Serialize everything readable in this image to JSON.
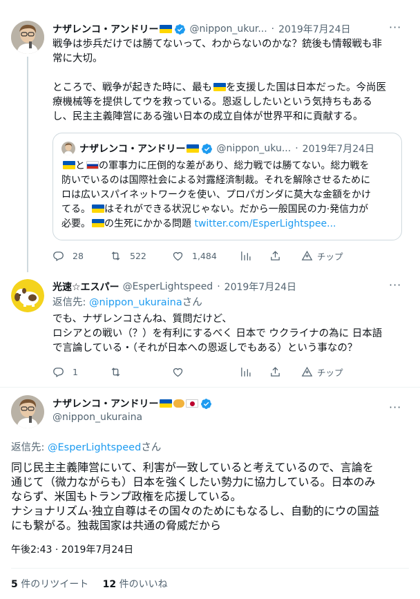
{
  "tweet1": {
    "name": "ナザレンコ・アンドリー",
    "handle": "@nippon_ukur...",
    "dot": "·",
    "date": "2019年7月24日",
    "text_line1": "戦争は歩兵だけでは勝てないって、わからないのかな？銃後も情報戦も非",
    "text_line2": "常に大切。",
    "text_line3a": "ところで、戦争が起きた時に、最も",
    "text_line3b": "を支援した国は日本だった。今尚医",
    "text_line4": "療機械等を提供してウを救っている。恩返ししたいという気持ちもある",
    "text_line5": "し、民主主義陣営にある強い日本の成立自体が世界平和に貢献する。",
    "quote": {
      "name": "ナザレンコ・アンドリー",
      "handle": "@nippon_uku...",
      "dot": "·",
      "date": "2019年7月24日",
      "line1a": "と",
      "line1b": "の軍事力に圧倒的な差があり、総力戦では勝てない。総力戦を",
      "line2": "防いでいるのは国際社会による対露経済制裁。それを解除させるために",
      "line3": "ロは広いスパイネットワークを使い、プロパガンダに莫大な金額をかけ",
      "line4a": "てる。",
      "line4b": "はそれができる状況じゃない。だから一般国民の力·発信力が",
      "line5": "必要。",
      "line6a": "の生死にかかる問題 ",
      "line6_link": "twitter.com/EsperLightspee..."
    },
    "replies": "28",
    "retweets": "522",
    "likes": "1,484",
    "tip": "チップ"
  },
  "tweet2": {
    "name": "光速☆エスパー",
    "handle": "@EsperLightspeed",
    "dot": "·",
    "date": "2019年7月24日",
    "reply_prefix": "返信先: ",
    "reply_to": "@nippon_ukuraina",
    "reply_suffix": "さん",
    "text_line1": "でも、ナザレンコさんね、質問だけど、",
    "text_line2": "ロシアとの戦い（？）を有利にするべく 日本で ウクライナの為に 日本語",
    "text_line3": "で言論している・（それが日本への恩返しでもある）という事なの？",
    "replies": "1",
    "tip": "チップ"
  },
  "tweet3": {
    "name": "ナザレンコ・アンドリー",
    "handle": "@nippon_ukuraina",
    "reply_prefix": "返信先: ",
    "reply_to": "@EsperLightspeed",
    "reply_suffix": "さん",
    "text_line1": "同じ民主主義陣営にいて、利害が一致していると考えているので、言論を",
    "text_line2": "通じて（微力ながらも）日本を強くしたい勢力に協力している。日本のみ",
    "text_line3": "ならず、米国もトランプ政権を応援している。",
    "text_line4": "ナショナリズム·独立自尊はその国々のためにもなるし、自動的にウの国益",
    "text_line5": "にも繋がる。独裁国家は共通の脅威だから",
    "timestamp": "午後2:43 · 2019年7月24日",
    "retweet_count": "5",
    "retweet_label": " 件のリツイート",
    "like_count": "12",
    "like_label": " 件のいいね"
  },
  "colors": {
    "accent": "#1d9bf0",
    "gray": "#536471",
    "ukraine_blue": "#0057b7",
    "ukraine_yellow": "#ffd700"
  },
  "icons": [
    "reply-icon",
    "retweet-icon",
    "like-icon",
    "analytics-icon",
    "share-icon",
    "tip-icon",
    "verified-icon",
    "more-icon"
  ]
}
